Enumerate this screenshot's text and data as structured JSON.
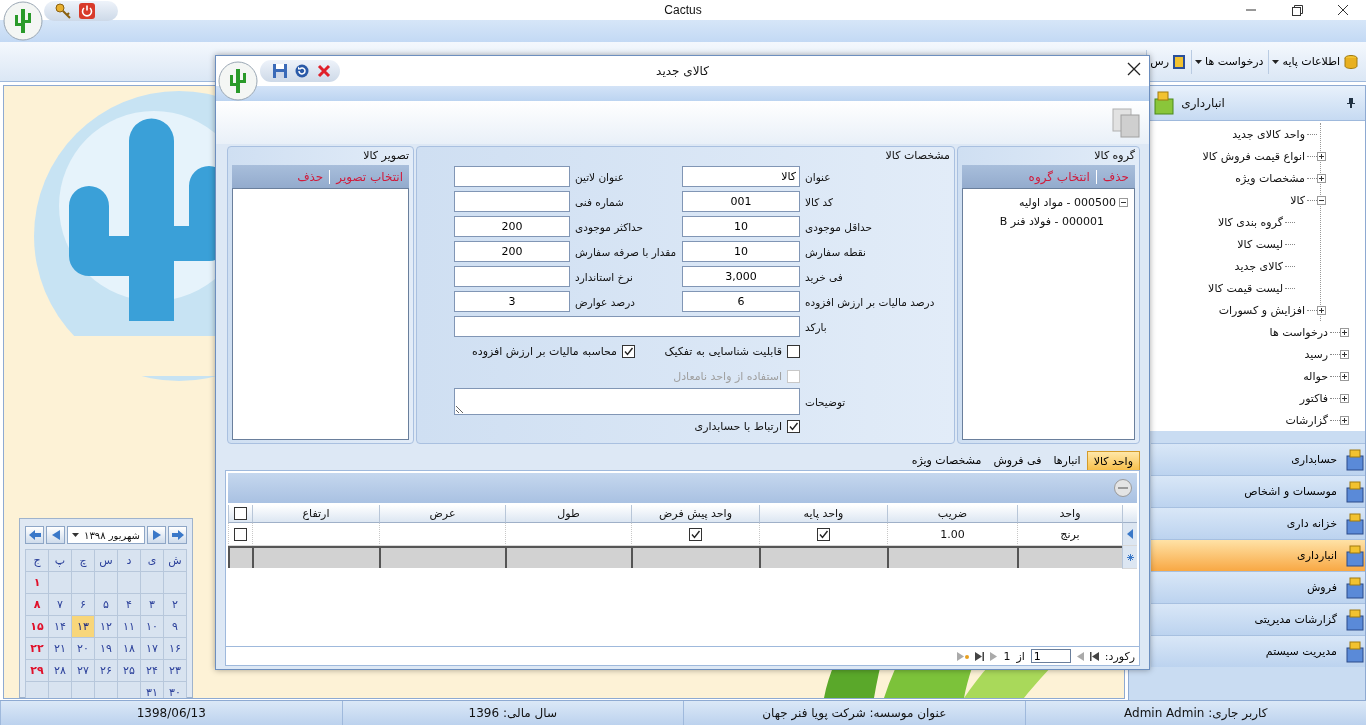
{
  "app": {
    "title": "Cactus"
  },
  "toolbar": [
    {
      "label": "اطلاعات پایه",
      "kind": "menu"
    },
    {
      "label": "درخواست ها",
      "kind": "menu"
    },
    {
      "label": "رس",
      "kind": "item"
    }
  ],
  "calendar": {
    "month_label": "شهریور ۱۳۹۸",
    "weekdays": [
      "ش",
      "ی",
      "د",
      "س",
      "چ",
      "پ",
      "ج"
    ],
    "weeks": [
      [
        {
          "day": "۱",
          "holiday": true,
          "selected": false
        }
      ],
      [
        {
          "day": "۲",
          "holiday": false,
          "selected": false
        },
        {
          "day": "۳",
          "holiday": false,
          "selected": false
        },
        {
          "day": "۴",
          "holiday": false,
          "selected": false
        },
        {
          "day": "۵",
          "holiday": false,
          "selected": false
        },
        {
          "day": "۶",
          "holiday": false,
          "selected": false
        },
        {
          "day": "۷",
          "holiday": false,
          "selected": false
        },
        {
          "day": "۸",
          "holiday": true,
          "selected": false
        }
      ],
      [
        {
          "day": "۹",
          "holiday": false,
          "selected": false
        },
        {
          "day": "۱۰",
          "holiday": false,
          "selected": false
        },
        {
          "day": "۱۱",
          "holiday": false,
          "selected": false
        },
        {
          "day": "۱۲",
          "holiday": false,
          "selected": false
        },
        {
          "day": "۱۳",
          "holiday": false,
          "selected": true
        },
        {
          "day": "۱۴",
          "holiday": false,
          "selected": false
        },
        {
          "day": "۱۵",
          "holiday": true,
          "selected": false
        }
      ],
      [
        {
          "day": "۱۶",
          "holiday": false,
          "selected": false
        },
        {
          "day": "۱۷",
          "holiday": false,
          "selected": false
        },
        {
          "day": "۱۸",
          "holiday": false,
          "selected": false
        },
        {
          "day": "۱۹",
          "holiday": false,
          "selected": false
        },
        {
          "day": "۲۰",
          "holiday": false,
          "selected": false
        },
        {
          "day": "۲۱",
          "holiday": false,
          "selected": false
        },
        {
          "day": "۲۲",
          "holiday": true,
          "selected": false
        }
      ],
      [
        {
          "day": "۲۳",
          "holiday": false,
          "selected": false
        },
        {
          "day": "۲۴",
          "holiday": false,
          "selected": false
        },
        {
          "day": "۲۵",
          "holiday": false,
          "selected": false
        },
        {
          "day": "۲۶",
          "holiday": false,
          "selected": false
        },
        {
          "day": "۲۷",
          "holiday": false,
          "selected": false
        },
        {
          "day": "۲۸",
          "holiday": false,
          "selected": false
        },
        {
          "day": "۲۹",
          "holiday": true,
          "selected": false
        }
      ],
      [
        {
          "day": "۳۰",
          "holiday": false,
          "selected": false
        },
        {
          "day": "۳۱",
          "holiday": false,
          "selected": false
        }
      ]
    ]
  },
  "sidebar": {
    "header": "انبارداری",
    "tree": [
      {
        "kind": "continued",
        "expanded": true,
        "children": [
          {
            "label": "واحد کالای جدید"
          },
          {
            "label": "انواع قیمت فروش کالا",
            "expanded": false
          },
          {
            "label": "مشخصات ویژه",
            "expanded": false
          },
          {
            "label": "کالا",
            "expanded": true,
            "children": [
              {
                "label": "گروه بندی کالا"
              },
              {
                "label": "لیست کالا"
              },
              {
                "label": "کالای جدید"
              },
              {
                "label": "لیست قیمت کالا"
              }
            ]
          },
          {
            "label": "افزایش و کسورات",
            "expanded": false
          }
        ]
      },
      {
        "kind": "node",
        "label": "درخواست ها",
        "expanded": false
      },
      {
        "kind": "node",
        "label": "رسید",
        "expanded": false
      },
      {
        "kind": "node",
        "label": "حواله",
        "expanded": false
      },
      {
        "kind": "node",
        "label": "فاکتور",
        "expanded": false
      },
      {
        "kind": "node",
        "label": "گزارشات",
        "expanded": false
      }
    ],
    "modules": [
      {
        "label": "حسابداری",
        "selected": false
      },
      {
        "label": "موسسات و اشخاص",
        "selected": false
      },
      {
        "label": "خزانه داری",
        "selected": false
      },
      {
        "label": "انبارداری",
        "selected": true
      },
      {
        "label": "فروش",
        "selected": false
      },
      {
        "label": "گزارشات مدیریتی",
        "selected": false
      },
      {
        "label": "مدیریت سیستم",
        "selected": false
      }
    ]
  },
  "dialog": {
    "title": "کالای جدید",
    "group_panel": {
      "title": "گروه کالا",
      "actions": [
        "حذف",
        "انتخاب گروه"
      ],
      "tree": [
        {
          "label": "000500 - مواد اولیه",
          "expanded": true,
          "children": [
            {
              "label": "000001 - فولاد فنر B"
            }
          ]
        }
      ]
    },
    "spec_panel": {
      "title": "مشخصات کالا",
      "fields": [
        {
          "label": "عنوان",
          "value": "کالا",
          "kind": "text"
        },
        {
          "label": "عنوان لاتین",
          "kind": "text"
        },
        {
          "label": "کد کالا",
          "value": "001",
          "kind": "number"
        },
        {
          "label": "شماره فنی",
          "kind": "text"
        },
        {
          "label": "حداقل موجودی",
          "value": "10",
          "kind": "number"
        },
        {
          "label": "حداکثر موجودی",
          "value": "200",
          "kind": "number"
        },
        {
          "label": "نقطه سفارش",
          "value": "10",
          "kind": "number"
        },
        {
          "label": "مقدار با صرفه سفارش",
          "value": "200",
          "kind": "number"
        },
        {
          "label": "فی خرید",
          "value": "3,000",
          "kind": "number"
        },
        {
          "label": "نرخ استاندارد",
          "kind": "number"
        },
        {
          "label": "درصد مالیات بر ارزش افزوده",
          "value": "6",
          "kind": "number"
        },
        {
          "label": "درصد عوارض",
          "value": "3",
          "kind": "number"
        },
        {
          "label": "بارکد",
          "kind": "wide"
        }
      ],
      "checks": [
        {
          "label": "قابلیت شناسایی به تفکیک",
          "checked": false,
          "disabled": false
        },
        {
          "label": "محاسبه مالیات بر ارزش افزوده",
          "checked": true,
          "disabled": false
        },
        {
          "label": "استفاده از واحد نامعادل",
          "checked": false,
          "disabled": true
        }
      ],
      "notes_label": "توضیحات",
      "link_check": {
        "label": "ارتباط با حسابداری",
        "checked": true
      }
    },
    "image_panel": {
      "title": "تصویر کالا",
      "actions": [
        "انتخاب تصویر",
        "حذف"
      ]
    },
    "tabs": [
      {
        "label": "واحد کالا",
        "selected": true
      },
      {
        "label": "انبارها",
        "selected": false
      },
      {
        "label": "فی فروش",
        "selected": false
      },
      {
        "label": "مشخصات ویژه",
        "selected": false
      }
    ],
    "grid": {
      "columns": [
        "واحد",
        "ضریب",
        "واحد پایه",
        "واحد پیش فرض",
        "طول",
        "عرض",
        "ارتفاع"
      ],
      "all_checked": false,
      "rows": [
        {
          "unit": "برنج",
          "factor": "1.00",
          "base_unit": true,
          "default_unit": true,
          "checked": false,
          "current": true
        }
      ]
    },
    "pager": {
      "label": "رکورد:",
      "value": "1",
      "of": "از",
      "total": "1"
    }
  },
  "status_bar": [
    "کاربر جاری: Admin Admin",
    "عنوان موسسه: شرکت پویا فنر جهان",
    "سال مالی: 1396",
    "1398/06/13"
  ]
}
